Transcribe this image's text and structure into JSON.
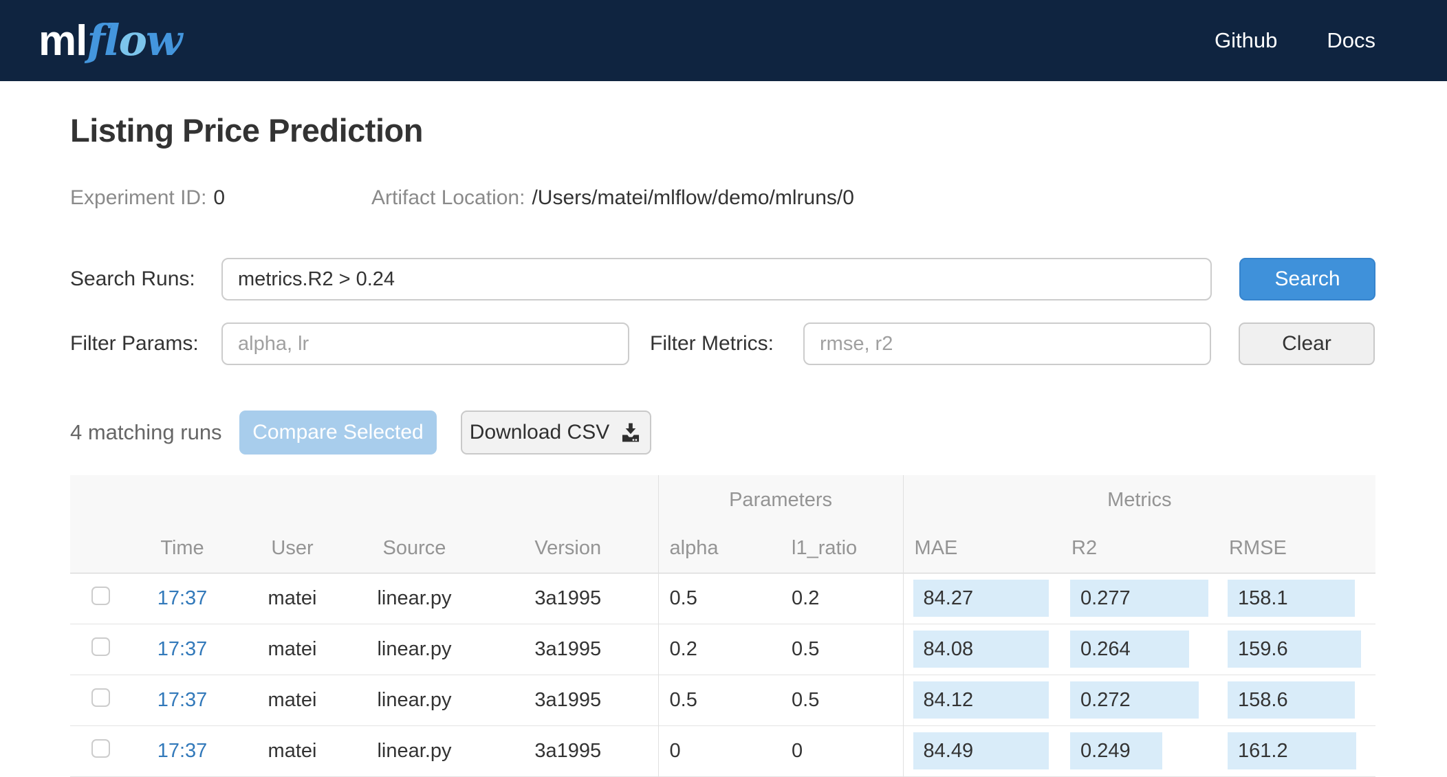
{
  "navbar": {
    "logo_ml": "ml",
    "logo_flow": "flow",
    "links": [
      {
        "label": "Github"
      },
      {
        "label": "Docs"
      }
    ]
  },
  "header": {
    "title": "Listing Price Prediction",
    "experiment_id_label": "Experiment ID:",
    "experiment_id_value": "0",
    "artifact_location_label": "Artifact Location:",
    "artifact_location_value": "/Users/matei/mlflow/demo/mlruns/0"
  },
  "search": {
    "label": "Search Runs:",
    "value": "metrics.R2 > 0.24",
    "button_label": "Search"
  },
  "filters": {
    "params_label": "Filter Params:",
    "params_placeholder": "alpha, lr",
    "metrics_label": "Filter Metrics:",
    "metrics_placeholder": "rmse, r2",
    "clear_button_label": "Clear"
  },
  "actions": {
    "matching_text": "4 matching runs",
    "compare_button_label": "Compare Selected",
    "download_button_label": "Download CSV"
  },
  "table": {
    "groups": {
      "parameters": "Parameters",
      "metrics": "Metrics"
    },
    "columns": [
      "Time",
      "User",
      "Source",
      "Version",
      "alpha",
      "l1_ratio",
      "MAE",
      "R2",
      "RMSE"
    ],
    "rows": [
      {
        "time": "17:37",
        "user": "matei",
        "source": "linear.py",
        "version": "3a1995",
        "alpha": "0.5",
        "l1_ratio": "0.2",
        "mae": {
          "value": "84.27",
          "bar": 197
        },
        "r2": {
          "value": "0.277",
          "bar": 201
        },
        "rmse": {
          "value": "158.1",
          "bar": 185
        }
      },
      {
        "time": "17:37",
        "user": "matei",
        "source": "linear.py",
        "version": "3a1995",
        "alpha": "0.2",
        "l1_ratio": "0.5",
        "mae": {
          "value": "84.08",
          "bar": 197
        },
        "r2": {
          "value": "0.264",
          "bar": 173
        },
        "rmse": {
          "value": "159.6",
          "bar": 194
        }
      },
      {
        "time": "17:37",
        "user": "matei",
        "source": "linear.py",
        "version": "3a1995",
        "alpha": "0.5",
        "l1_ratio": "0.5",
        "mae": {
          "value": "84.12",
          "bar": 197
        },
        "r2": {
          "value": "0.272",
          "bar": 187
        },
        "rmse": {
          "value": "158.6",
          "bar": 185
        }
      },
      {
        "time": "17:37",
        "user": "matei",
        "source": "linear.py",
        "version": "3a1995",
        "alpha": "0",
        "l1_ratio": "0",
        "mae": {
          "value": "84.49",
          "bar": 197
        },
        "r2": {
          "value": "0.249",
          "bar": 134
        },
        "rmse": {
          "value": "161.2",
          "bar": 187
        }
      }
    ]
  },
  "colors": {
    "navbar_bg": "#0f2440",
    "logo_blue": "#4496dd",
    "primary_button": "#3f91da",
    "disabled_button": "#a8cdec",
    "metric_highlight": "#d9ecf9",
    "link_blue": "#3279ba"
  }
}
